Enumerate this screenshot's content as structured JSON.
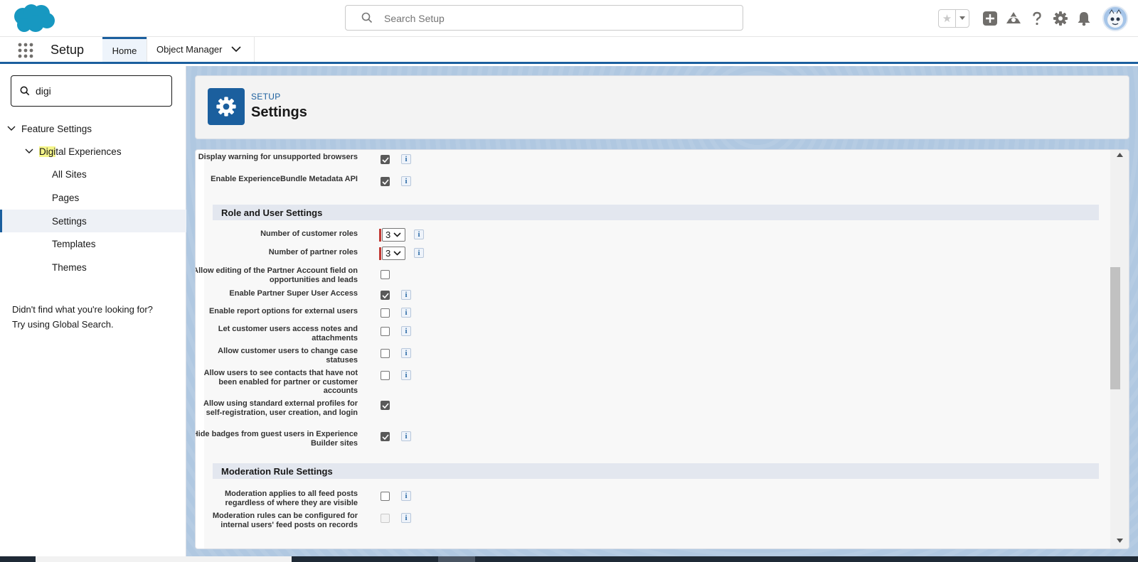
{
  "header": {
    "search_placeholder": "Search Setup"
  },
  "context_bar": {
    "app_name": "Setup",
    "tabs": [
      {
        "label": "Home"
      },
      {
        "label": "Object Manager"
      }
    ]
  },
  "sidebar": {
    "search_value": "digi",
    "tree": {
      "feature_settings": "Feature Settings",
      "digital_experiences_hl": "Digi",
      "digital_experiences_rest": "tal Experiences",
      "items": [
        "All Sites",
        "Pages",
        "Settings",
        "Templates",
        "Themes"
      ]
    },
    "note_line1": "Didn't find what you're looking for?",
    "note_line2": "Try using Global Search."
  },
  "page_header": {
    "eyebrow": "SETUP",
    "title": "Settings"
  },
  "settings": {
    "top_rows": [
      {
        "label": "Display warning for unsupported browsers",
        "checked": true,
        "info": true
      },
      {
        "label": "Enable ExperienceBundle Metadata API",
        "checked": true,
        "info": true
      }
    ],
    "role_section_title": "Role and User Settings",
    "customer_roles_label": "Number of customer roles",
    "customer_roles_value": "3",
    "partner_roles_label": "Number of partner roles",
    "partner_roles_value": "3",
    "role_rows": [
      {
        "label": "Allow editing of the Partner Account field on opportunities and leads",
        "checked": false,
        "info": false
      },
      {
        "label": "Enable Partner Super User Access",
        "checked": true,
        "info": true
      },
      {
        "label": "Enable report options for external users",
        "checked": false,
        "info": true
      },
      {
        "label": "Let customer users access notes and attachments",
        "checked": false,
        "info": true
      },
      {
        "label": "Allow customer users to change case statuses",
        "checked": false,
        "info": true
      },
      {
        "label": "Allow users to see contacts that have not been enabled for partner or customer accounts",
        "checked": false,
        "info": true
      },
      {
        "label": "Allow using standard external profiles for self-registration, user creation, and login",
        "checked": true,
        "info": false
      },
      {
        "label": "Hide badges from guest users in Experience Builder sites",
        "checked": true,
        "info": true
      }
    ],
    "moderation_section_title": "Moderation Rule Settings",
    "moderation_rows": [
      {
        "label": "Moderation applies to all feed posts regardless of where they are visible",
        "checked": false,
        "info": true
      },
      {
        "label": "Moderation rules can be configured for internal users' feed posts on records",
        "checked": false,
        "disabled": true,
        "info": true
      }
    ],
    "info_glyph": "i"
  },
  "colors": {
    "brand": "#1b5f9e",
    "required": "#c23934",
    "highlight": "#f5f58a"
  }
}
